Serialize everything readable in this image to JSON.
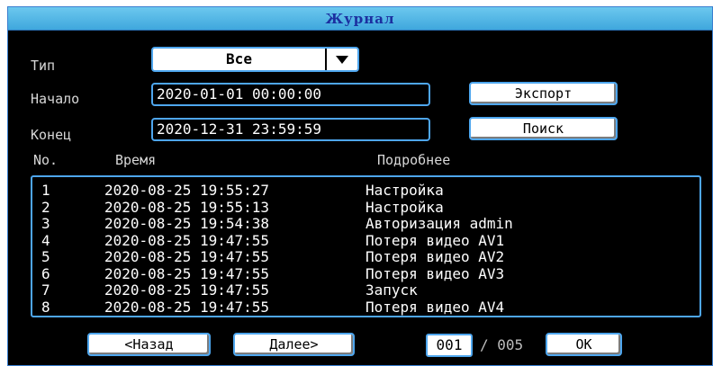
{
  "window": {
    "title": "Журнал"
  },
  "filters": {
    "type_label": "Тип",
    "type_value": "Все",
    "start_label": "Начало",
    "start_value": "2020-01-01 00:00:00",
    "end_label": "Конец",
    "end_value": "2020-12-31 23:59:59"
  },
  "actions": {
    "export_label": "Экспорт",
    "search_label": "Поиск"
  },
  "table": {
    "columns": [
      "No.",
      "Время",
      "Подробнее"
    ],
    "rows": [
      {
        "no": "1",
        "time": "2020-08-25 19:55:27",
        "detail": "Настройка"
      },
      {
        "no": "2",
        "time": "2020-08-25 19:55:13",
        "detail": "Настройка"
      },
      {
        "no": "3",
        "time": "2020-08-25 19:54:38",
        "detail": "Авторизация admin"
      },
      {
        "no": "4",
        "time": "2020-08-25 19:47:55",
        "detail": "Потеря видео AV1"
      },
      {
        "no": "5",
        "time": "2020-08-25 19:47:55",
        "detail": "Потеря видео AV2"
      },
      {
        "no": "6",
        "time": "2020-08-25 19:47:55",
        "detail": "Потеря видео AV3"
      },
      {
        "no": "7",
        "time": "2020-08-25 19:47:55",
        "detail": "Запуск"
      },
      {
        "no": "8",
        "time": "2020-08-25 19:47:55",
        "detail": "Потеря видео AV4"
      }
    ]
  },
  "pager": {
    "prev_label": "<Назад",
    "next_label": "Далее>",
    "current_page": "001",
    "total_pages": "/ 005",
    "ok_label": "OK"
  },
  "colors": {
    "accent_border": "#4ea6ee",
    "title_bar": "#3fa7dd",
    "title_text": "#1b2fa0",
    "background": "#000000"
  },
  "icons": {
    "dropdown": "triangle-down-icon"
  }
}
